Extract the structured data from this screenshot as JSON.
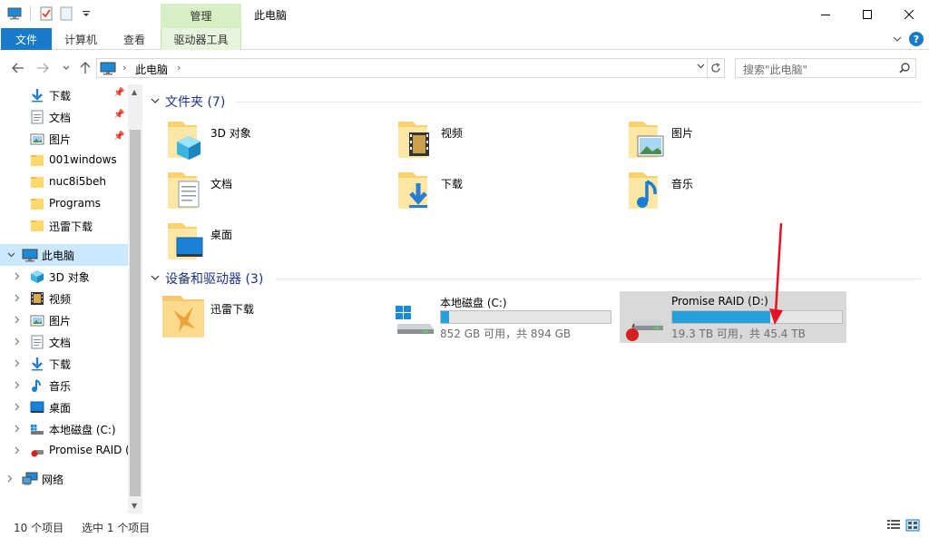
{
  "window": {
    "title": "此电脑",
    "context_tab_group": "管理"
  },
  "ribbon": {
    "tabs": [
      {
        "label": "文件"
      },
      {
        "label": "计算机"
      },
      {
        "label": "查看"
      },
      {
        "label": "驱动器工具"
      }
    ]
  },
  "address": {
    "path": "此电脑",
    "search_placeholder": "搜索\"此电脑\""
  },
  "nav_pane": {
    "quick_access": [
      {
        "label": "下载",
        "icon": "download-arrow-icon",
        "pinned": true
      },
      {
        "label": "文档",
        "icon": "document-icon",
        "pinned": true
      },
      {
        "label": "图片",
        "icon": "pictures-icon",
        "pinned": true
      },
      {
        "label": "001windows",
        "icon": "folder-icon",
        "pinned": false
      },
      {
        "label": "nuc8i5beh",
        "icon": "folder-icon",
        "pinned": false
      },
      {
        "label": "Programs",
        "icon": "folder-icon",
        "pinned": false
      },
      {
        "label": "迅雷下载",
        "icon": "folder-icon",
        "pinned": false
      }
    ],
    "this_pc": {
      "label": "此电脑",
      "selected": true
    },
    "this_pc_children": [
      {
        "label": "3D 对象",
        "icon": "3d-objects-icon"
      },
      {
        "label": "视频",
        "icon": "videos-icon"
      },
      {
        "label": "图片",
        "icon": "pictures-icon"
      },
      {
        "label": "文档",
        "icon": "document-icon"
      },
      {
        "label": "下载",
        "icon": "download-arrow-icon"
      },
      {
        "label": "音乐",
        "icon": "music-icon"
      },
      {
        "label": "桌面",
        "icon": "desktop-icon"
      },
      {
        "label": "本地磁盘 (C:)",
        "icon": "windows-drive-icon"
      },
      {
        "label": "Promise RAID (",
        "icon": "raid-drive-icon"
      }
    ],
    "network": {
      "label": "网络"
    }
  },
  "content": {
    "folders_group": {
      "title": "文件夹 (7)"
    },
    "folders": [
      {
        "label": "3D 对象",
        "icon": "3d-objects-folder-icon"
      },
      {
        "label": "视频",
        "icon": "videos-folder-icon"
      },
      {
        "label": "图片",
        "icon": "pictures-folder-icon"
      },
      {
        "label": "文档",
        "icon": "documents-folder-icon"
      },
      {
        "label": "下载",
        "icon": "downloads-folder-icon"
      },
      {
        "label": "音乐",
        "icon": "music-folder-icon"
      },
      {
        "label": "桌面",
        "icon": "desktop-folder-icon"
      }
    ],
    "devices_group": {
      "title": "设备和驱动器 (3)"
    },
    "devices": [
      {
        "label": "迅雷下载",
        "icon": "xunlei-icon"
      },
      {
        "label": "本地磁盘 (C:)",
        "free": "852 GB 可用，共 894 GB",
        "used_fraction": 0.047,
        "icon": "windows-drive-icon"
      },
      {
        "label": "Promise RAID (D:)",
        "free": "19.3 TB 可用，共 45.4 TB",
        "used_fraction": 0.575,
        "icon": "raid-drive-icon",
        "selected": true
      }
    ]
  },
  "status": {
    "item_count": "10 个项目",
    "selection": "选中 1 个项目"
  },
  "colors": {
    "accent": "#1979ca",
    "group_header": "#1e3287",
    "drive_bar": "#26a0da",
    "annotation_arrow": "#e81123"
  }
}
